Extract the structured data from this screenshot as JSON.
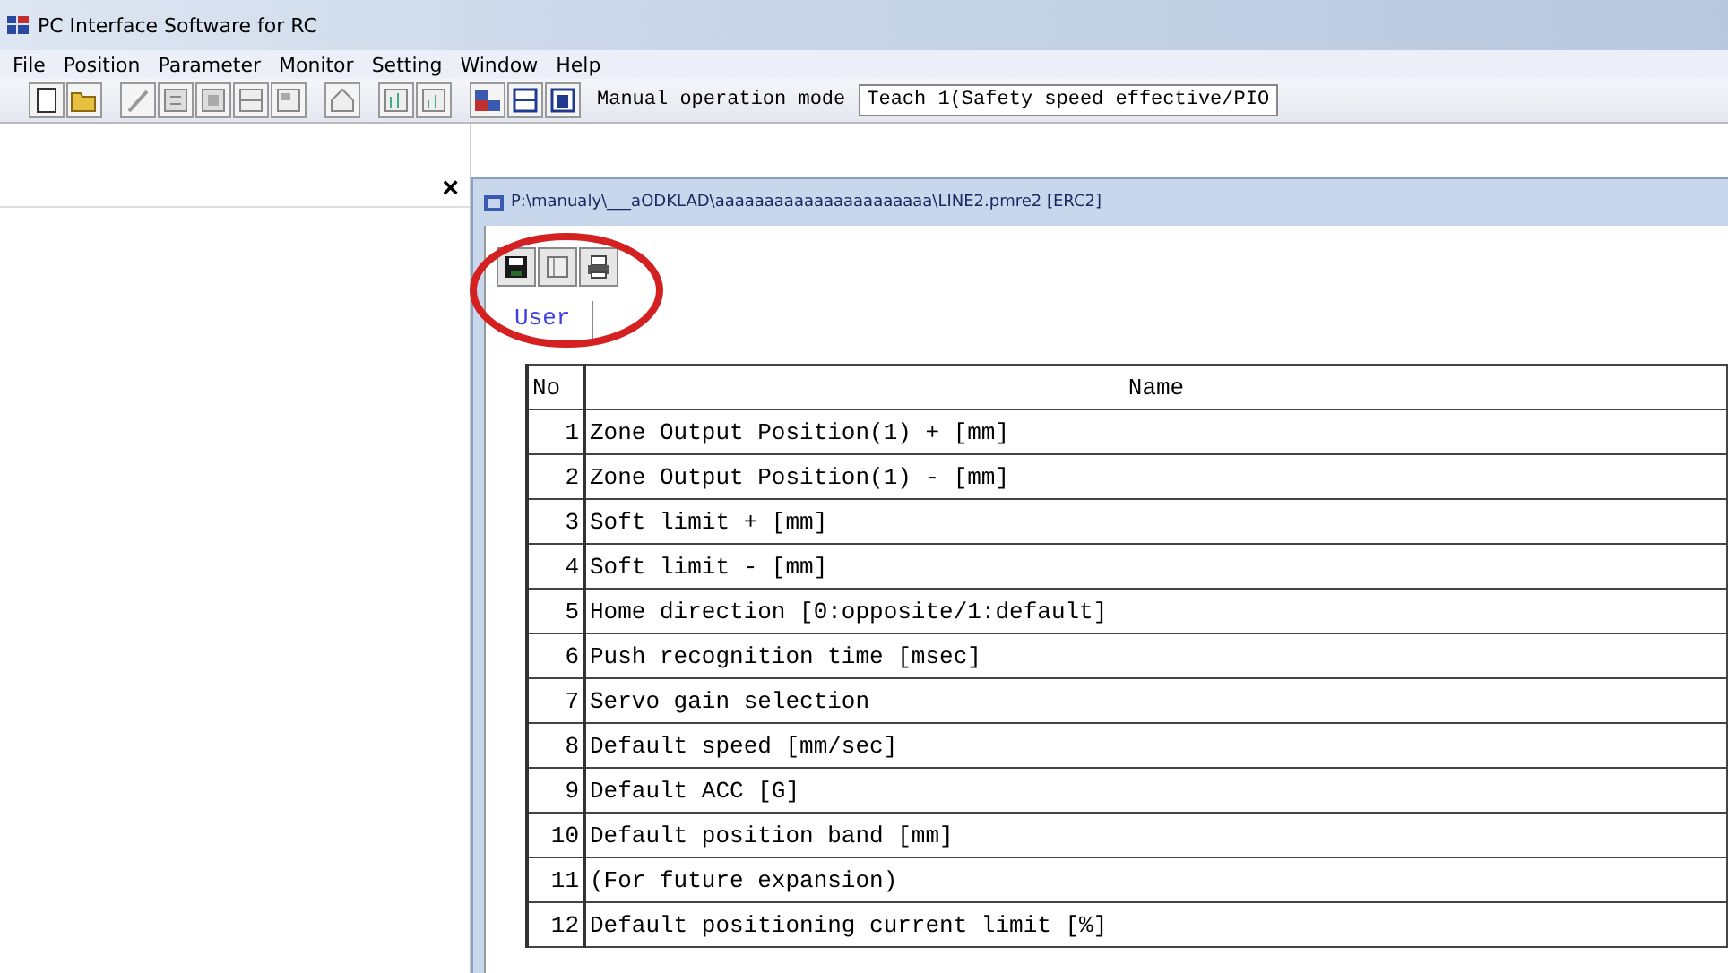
{
  "window": {
    "title": "PC Interface Software for RC"
  },
  "menu": [
    "File",
    "Position",
    "Parameter",
    "Monitor",
    "Setting",
    "Window",
    "Help"
  ],
  "toolbar": {
    "mode_label": "Manual operation mode",
    "mode_value": "Teach 1(Safety speed effective/PIO"
  },
  "side_panel": {
    "close": "×"
  },
  "child_window": {
    "title": "P:\\manualy\\___aODKLAD\\aaaaaaaaaaaaaaaaaaaaaa\\LINE2.pmre2 [ERC2]",
    "tabs": [
      {
        "label": "User",
        "selected": true
      }
    ],
    "table": {
      "columns": [
        "No",
        "Name"
      ],
      "rows": [
        [
          "1",
          "Zone Output Position(1) + [mm]"
        ],
        [
          "2",
          "Zone Output Position(1) - [mm]"
        ],
        [
          "3",
          "Soft limit + [mm]"
        ],
        [
          "4",
          "Soft limit - [mm]"
        ],
        [
          "5",
          "Home direction [0:opposite/1:default]"
        ],
        [
          "6",
          "Push recognition time [msec]"
        ],
        [
          "7",
          "Servo gain selection"
        ],
        [
          "8",
          "Default speed [mm/sec]"
        ],
        [
          "9",
          "Default ACC [G]"
        ],
        [
          "10",
          "Default position band [mm]"
        ],
        [
          "11",
          "(For future expansion)"
        ],
        [
          "12",
          "Default positioning current limit [%]"
        ]
      ]
    }
  }
}
